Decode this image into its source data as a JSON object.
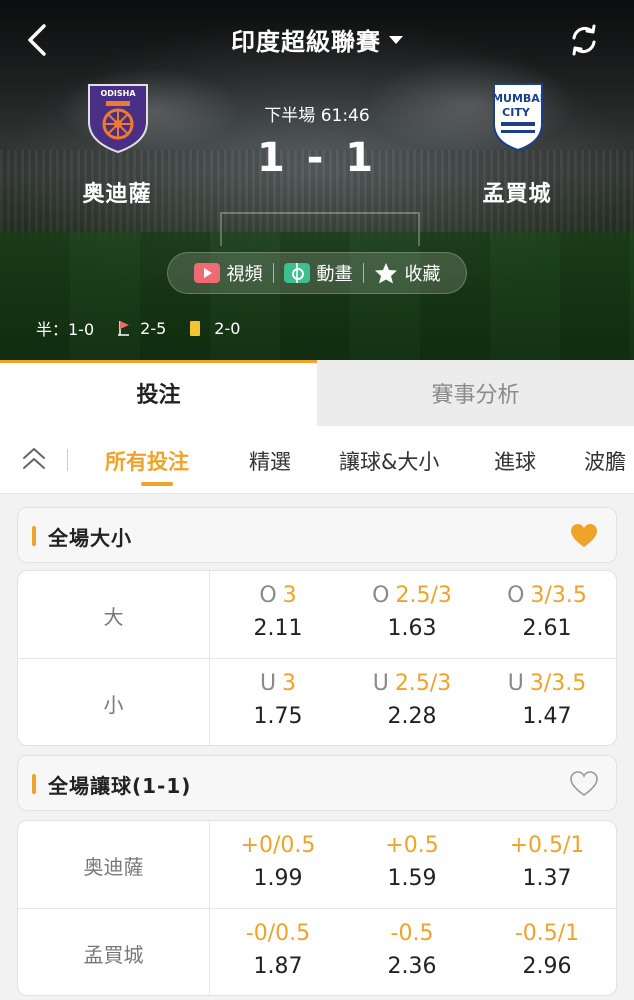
{
  "header": {
    "league": "印度超級聯賽",
    "status": "下半場 61:46",
    "score": "1 - 1",
    "home": {
      "name": "奥迪薩",
      "logo_text": "ODISHA"
    },
    "away": {
      "name": "孟買城",
      "logo_text_1": "MUMBAI",
      "logo_text_2": "CITY"
    },
    "media": {
      "video": "視頻",
      "animation": "動畫",
      "favorite": "收藏"
    },
    "stats": {
      "half_label": "半：1-0",
      "corners": "2-5",
      "yellow_cards": "2-0"
    }
  },
  "main_tabs": {
    "bet": "投注",
    "analysis": "賽事分析"
  },
  "sub_tabs": {
    "all": "所有投注",
    "featured": "精選",
    "handicap_ou": "讓球&大小",
    "goals": "進球",
    "wave": "波膽"
  },
  "markets": {
    "totals": {
      "title": "全場大小",
      "favorited": true,
      "rows": [
        {
          "label": "大",
          "cells": [
            {
              "prefix": "O",
              "line": "3",
              "odds": "2.11"
            },
            {
              "prefix": "O",
              "line": "2.5/3",
              "odds": "1.63"
            },
            {
              "prefix": "O",
              "line": "3/3.5",
              "odds": "2.61"
            }
          ]
        },
        {
          "label": "小",
          "cells": [
            {
              "prefix": "U",
              "line": "3",
              "odds": "1.75"
            },
            {
              "prefix": "U",
              "line": "2.5/3",
              "odds": "2.28"
            },
            {
              "prefix": "U",
              "line": "3/3.5",
              "odds": "1.47"
            }
          ]
        }
      ]
    },
    "handicap": {
      "title": "全場讓球(1-1)",
      "favorited": false,
      "rows": [
        {
          "label": "奥迪薩",
          "cells": [
            {
              "line": "+0/0.5",
              "odds": "1.99"
            },
            {
              "line": "+0.5",
              "odds": "1.59"
            },
            {
              "line": "+0.5/1",
              "odds": "1.37"
            }
          ]
        },
        {
          "label": "孟買城",
          "cells": [
            {
              "line": "-0/0.5",
              "odds": "1.87"
            },
            {
              "line": "-0.5",
              "odds": "2.36"
            },
            {
              "line": "-0.5/1",
              "odds": "2.96"
            }
          ]
        }
      ]
    }
  },
  "colors": {
    "accent": "#f0a32a",
    "video": "#ef6b73",
    "animation": "#3fbf8f",
    "yellow_card": "#f4c430",
    "odisha_badge": "#4a2f86"
  }
}
